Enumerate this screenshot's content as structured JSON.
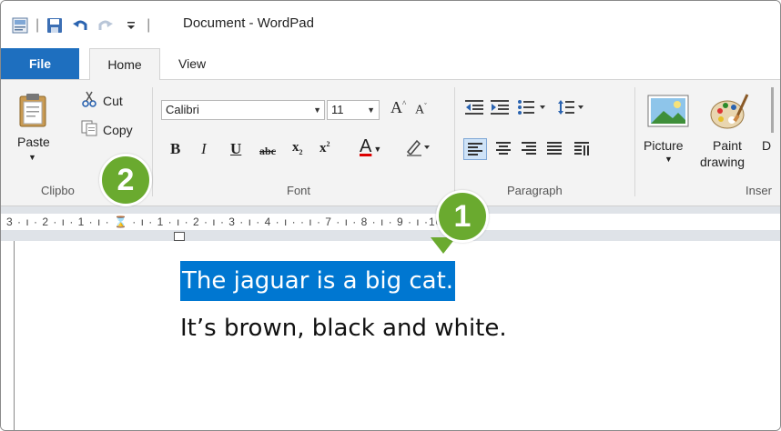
{
  "window": {
    "title": "Document - WordPad"
  },
  "tabs": {
    "file": "File",
    "home": "Home",
    "view": "View"
  },
  "clipboard": {
    "paste": "Paste",
    "cut": "Cut",
    "copy": "Copy",
    "group_label": "Clipbo"
  },
  "font": {
    "family": "Calibri",
    "size": "11",
    "group_label": "Font"
  },
  "paragraph": {
    "group_label": "Paragraph"
  },
  "insert": {
    "picture": "Picture",
    "paint_line1": "Paint",
    "paint_line2": "drawing",
    "group_label": "Inser",
    "cut_off": "D"
  },
  "ruler": {
    "text": "3 · ı · 2 · ı · 1 · ı ·  ⌛ · ı · 1 · ı · 2 · ı · 3 · ı · 4 · ı ·                 · ı · 7 · ı · 8 · ı · 9 · ı ·10· ı ·11· ı"
  },
  "document": {
    "line1": "The jaguar is a big cat.",
    "line2": "It’s brown, black and white."
  },
  "callouts": {
    "one": "1",
    "two": "2"
  },
  "colors": {
    "accent": "#1e6fbf",
    "selection": "#0077d1",
    "callout": "#6aaa2f"
  }
}
